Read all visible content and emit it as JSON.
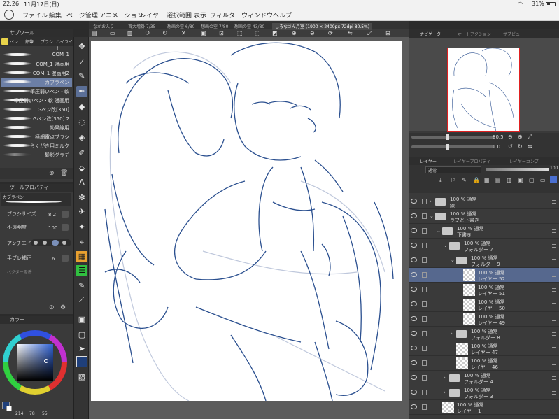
{
  "status": {
    "time": "22:26",
    "date": "11月17日(日)",
    "battery": "31%"
  },
  "menu": [
    "ファイル",
    "編集",
    "ページ管理",
    "アニメーション",
    "レイヤー",
    "選択範囲",
    "表示",
    "フィルター",
    "ウィンドウ",
    "ヘルプ"
  ],
  "tabs": [
    "なかお入り",
    "首大増掛 7/35",
    "想画の空 6/80",
    "想画の空 7/80",
    "想画の空 43/80",
    "しろなさん月室 (1900 × 2400px 72dpi 80.5%)"
  ],
  "subtool": {
    "title": "サブツール",
    "tabs": [
      "ペン",
      "鉛筆",
      "ブラシ",
      "ハイライト"
    ],
    "brushes": [
      "COM_1",
      "COM_1 漫画用",
      "COM_1 漫画用2",
      "カブラペン",
      "筆圧弱いペン・軟",
      "筆圧弱いペン・軟 漫画用",
      "Gペン改[350]",
      "Gペン改[350] 2",
      "効果線用",
      "極細電点ブラシ",
      "らくがき用ミルク",
      "髪影グラデ"
    ]
  },
  "toolprop": {
    "title": "ツールプロパティ",
    "brush_name": "カブラペン",
    "size_label": "ブラシサイズ",
    "size_value": "8.2",
    "opacity_label": "不透明度",
    "opacity_value": "100",
    "aa_label": "アンチエイリアス",
    "stab_label": "手ブレ補正",
    "stab_value": "6",
    "vector_label": "ベクター吸着"
  },
  "color": {
    "title": "カラー",
    "r": "214",
    "g": "78",
    "b": "55",
    "main_color": "#1f3f7a",
    "sub_color": "#ffffff"
  },
  "navigator": {
    "tabs": [
      "ナビゲーター",
      "オートアクション",
      "サブビュー"
    ],
    "zoom": "80.5",
    "angle": "0.0"
  },
  "layers": {
    "tabs": [
      "レイヤー",
      "レイヤープロパティ",
      "レイヤーカンプ"
    ],
    "blend_mode": "通常",
    "opacity": "100",
    "rows": [
      {
        "l1": "100 % 通常",
        "l2": "線",
        "type": "folder",
        "indent": 0,
        "tw": "›"
      },
      {
        "l1": "100 % 通常",
        "l2": "ラフと下書き",
        "type": "folder",
        "indent": 0,
        "tw": "⌄"
      },
      {
        "l1": "100 % 通常",
        "l2": "下書き",
        "type": "folder",
        "indent": 1,
        "tw": "⌄"
      },
      {
        "l1": "100 % 通常",
        "l2": "フォルダー 7",
        "type": "folder",
        "indent": 2,
        "tw": "⌄"
      },
      {
        "l1": "100 % 通常",
        "l2": "フォルダー 9",
        "type": "folder",
        "indent": 3,
        "tw": "⌄"
      },
      {
        "l1": "100 % 通常",
        "l2": "レイヤー 52",
        "type": "layer",
        "indent": 4,
        "sel": true
      },
      {
        "l1": "100 % 通常",
        "l2": "レイヤー 51",
        "type": "layer",
        "indent": 4
      },
      {
        "l1": "100 % 通常",
        "l2": "レイヤー 50",
        "type": "layer",
        "indent": 4
      },
      {
        "l1": "100 % 通常",
        "l2": "レイヤー 49",
        "type": "layer",
        "indent": 4
      },
      {
        "l1": "100 % 通常",
        "l2": "フォルダー 8",
        "type": "folder",
        "indent": 3,
        "tw": "›"
      },
      {
        "l1": "100 % 通常",
        "l2": "レイヤー 47",
        "type": "layer",
        "indent": 3
      },
      {
        "l1": "100 % 通常",
        "l2": "レイヤー 46",
        "type": "layer",
        "indent": 3
      },
      {
        "l1": "100 % 通常",
        "l2": "フォルダー 4",
        "type": "folder",
        "indent": 2,
        "tw": "›"
      },
      {
        "l1": "100 % 通常",
        "l2": "フォルダー 3",
        "type": "folder",
        "indent": 2,
        "tw": "›"
      },
      {
        "l1": "100 % 通常",
        "l2": "レイヤー 1",
        "type": "layer",
        "indent": 1
      }
    ]
  }
}
